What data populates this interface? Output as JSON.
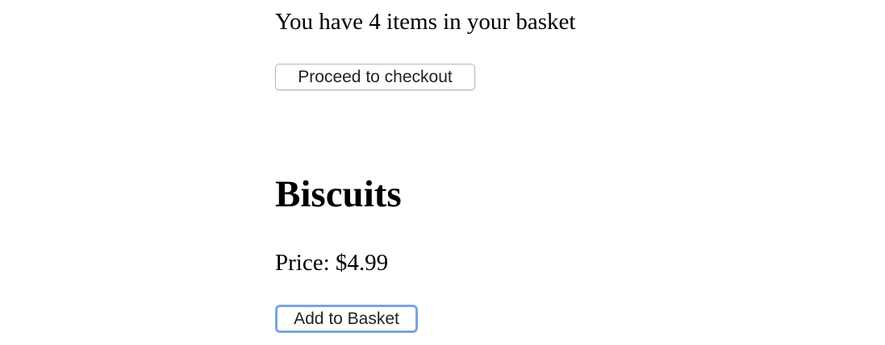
{
  "basket": {
    "summary": "You have 4 items in your basket",
    "checkout_label": "Proceed to checkout"
  },
  "product": {
    "name": "Biscuits",
    "price_text": "Price: $4.99",
    "add_label": "Add to Basket"
  },
  "colors": {
    "focus_ring": "#7aa6dc",
    "text": "#000000",
    "background": "#ffffff"
  }
}
